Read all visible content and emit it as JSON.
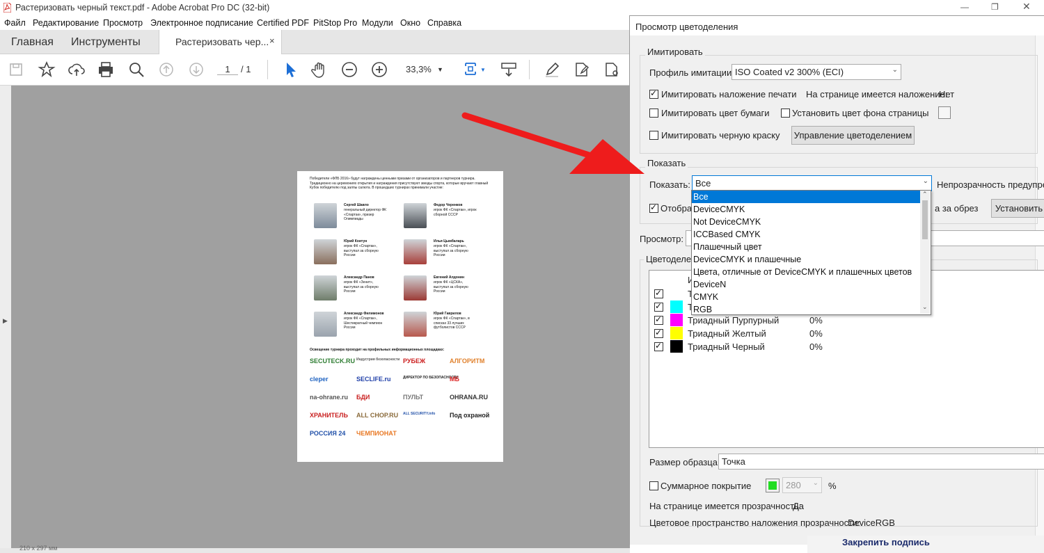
{
  "window": {
    "title": "Растеризовать черный текст.pdf - Adobe Acrobat Pro DC (32-bit)"
  },
  "menu": [
    "Файл",
    "Редактирование",
    "Просмотр",
    "Электронное подписание",
    "Certified PDF",
    "PitStop Pro",
    "Модули",
    "Окно",
    "Справка"
  ],
  "tabs": {
    "home": "Главная",
    "tools": "Инструменты",
    "document": "Растеризовать чер...",
    "close": "×"
  },
  "toolbar": {
    "page_current": "1",
    "page_total": "/ 1",
    "zoom": "33,3%"
  },
  "status": {
    "size": "210 x 297 мм"
  },
  "page_content": {
    "intro": "Победители «ФЛБ 2016» будут награждены ценными призами от организаторов и партнеров турнира. Традиционно на церемониях открытия и награждения присутствуют звезды спорта, которые вручают главный Кубок победителю под залпы салюта. В прошедших турнирах принимали участие:",
    "players": [
      {
        "name": "Сергей Шавло",
        "desc": "генеральный директор ФК «Спартак», призер Олимпиады"
      },
      {
        "name": "Федор Черенков",
        "desc": "игрок ФК «Спартак», игрок сборной СССР"
      },
      {
        "name": "Юрий Коитун",
        "desc": "игрок ФК «Спартак», выступал за сборную России"
      },
      {
        "name": "Илья Цымбаларь",
        "desc": "игрок ФК «Спартак», выступал за сборную России"
      },
      {
        "name": "Александр Панов",
        "desc": "игрок ФК «Зенит», выступал за сборную России"
      },
      {
        "name": "Евгений Алдонин",
        "desc": "игрок ФК «ЦСКА», выступал за сборную России"
      },
      {
        "name": "Александр Филимонов",
        "desc": "игрок ФК «Спартак», Шестикратный чемпион России"
      },
      {
        "name": "Юрий Гаврилов",
        "desc": "игрок ФК «Спартак», в списках 33 лучших футболистов СССР"
      }
    ],
    "media": "Освещение турнира проходит на профильных информационных площадках:",
    "logos": [
      "SECUTECK.RU",
      "Индустрия безопасности",
      "РУБЕЖ",
      "АЛГОРИТМ",
      "cleper",
      "SECLIFE.ru",
      "ДИРЕКТОР ПО БЕЗОПАСНОСТИ",
      "МБ",
      "na-ohrane.ru",
      "БДИ",
      "ПУЛЬТ",
      "OHRANA.RU",
      "ХРАНИТЕЛЬ",
      "ALL CHOP.RU",
      "ALL SECURITY.info",
      "Под охраной",
      "РОССИЯ 24",
      "ЧЕМПИОНАТ"
    ]
  },
  "dialog": {
    "title": "Просмотр цветоделения",
    "simulate_group": "Имитировать",
    "profile_label": "Профиль имитации:",
    "profile_value": "ISO Coated v2 300% (ECI)",
    "sim_overprint": "Имитировать наложение печати",
    "overprint_status_label": "На странице имеется наложение:",
    "overprint_status_value": "Нет",
    "sim_paper": "Имитировать цвет бумаги",
    "set_page_bg": "Установить цвет фона страницы",
    "sim_black": "Имитировать черную краску",
    "manage_button": "Управление цветоделением",
    "show_group": "Показать",
    "show_label": "Показать:",
    "show_value": "Все",
    "opacity_warn": "Непрозрачность предупреж",
    "display_cb": "Отображ",
    "bleed_text": "а за обрез",
    "set_button": "Установить",
    "preview_label": "Просмотр:",
    "separations_label": "Цветоделени",
    "dropdown_options": [
      "Все",
      "DeviceCMYK",
      "Not DeviceCMYK",
      "ICCBased CMYK",
      "Плашечный цвет",
      "DeviceCMYK и плашечные",
      "Цвета, отличные от DeviceCMYK и плашечных цветов",
      "DeviceN",
      "CMYK",
      "RGB"
    ],
    "list_header": "И",
    "separations": [
      {
        "name": "Т",
        "pct": "",
        "color": "#ffffff"
      },
      {
        "name": "Т",
        "pct": "",
        "color": "#00ffff"
      },
      {
        "name": "Триадный Пурпурный",
        "pct": "0%",
        "color": "#ff00ff"
      },
      {
        "name": "Триадный Желтый",
        "pct": "0%",
        "color": "#ffff00"
      },
      {
        "name": "Триадный Черный",
        "pct": "0%",
        "color": "#000000"
      }
    ],
    "sample_size_label": "Размер образца:",
    "sample_size_value": "Точка",
    "total_coverage_label": "Суммарное покрытие",
    "total_coverage_value": "280",
    "percent": "%",
    "transparency_label": "На странице имеется прозрачность:",
    "transparency_value": "Да",
    "blend_space_label": "Цветовое пространство наложения прозрачности:",
    "blend_space_value": "DeviceRGB",
    "coverage_color": "#22dd22"
  },
  "behind_dialog": {
    "text": "Закрепить подпись"
  }
}
